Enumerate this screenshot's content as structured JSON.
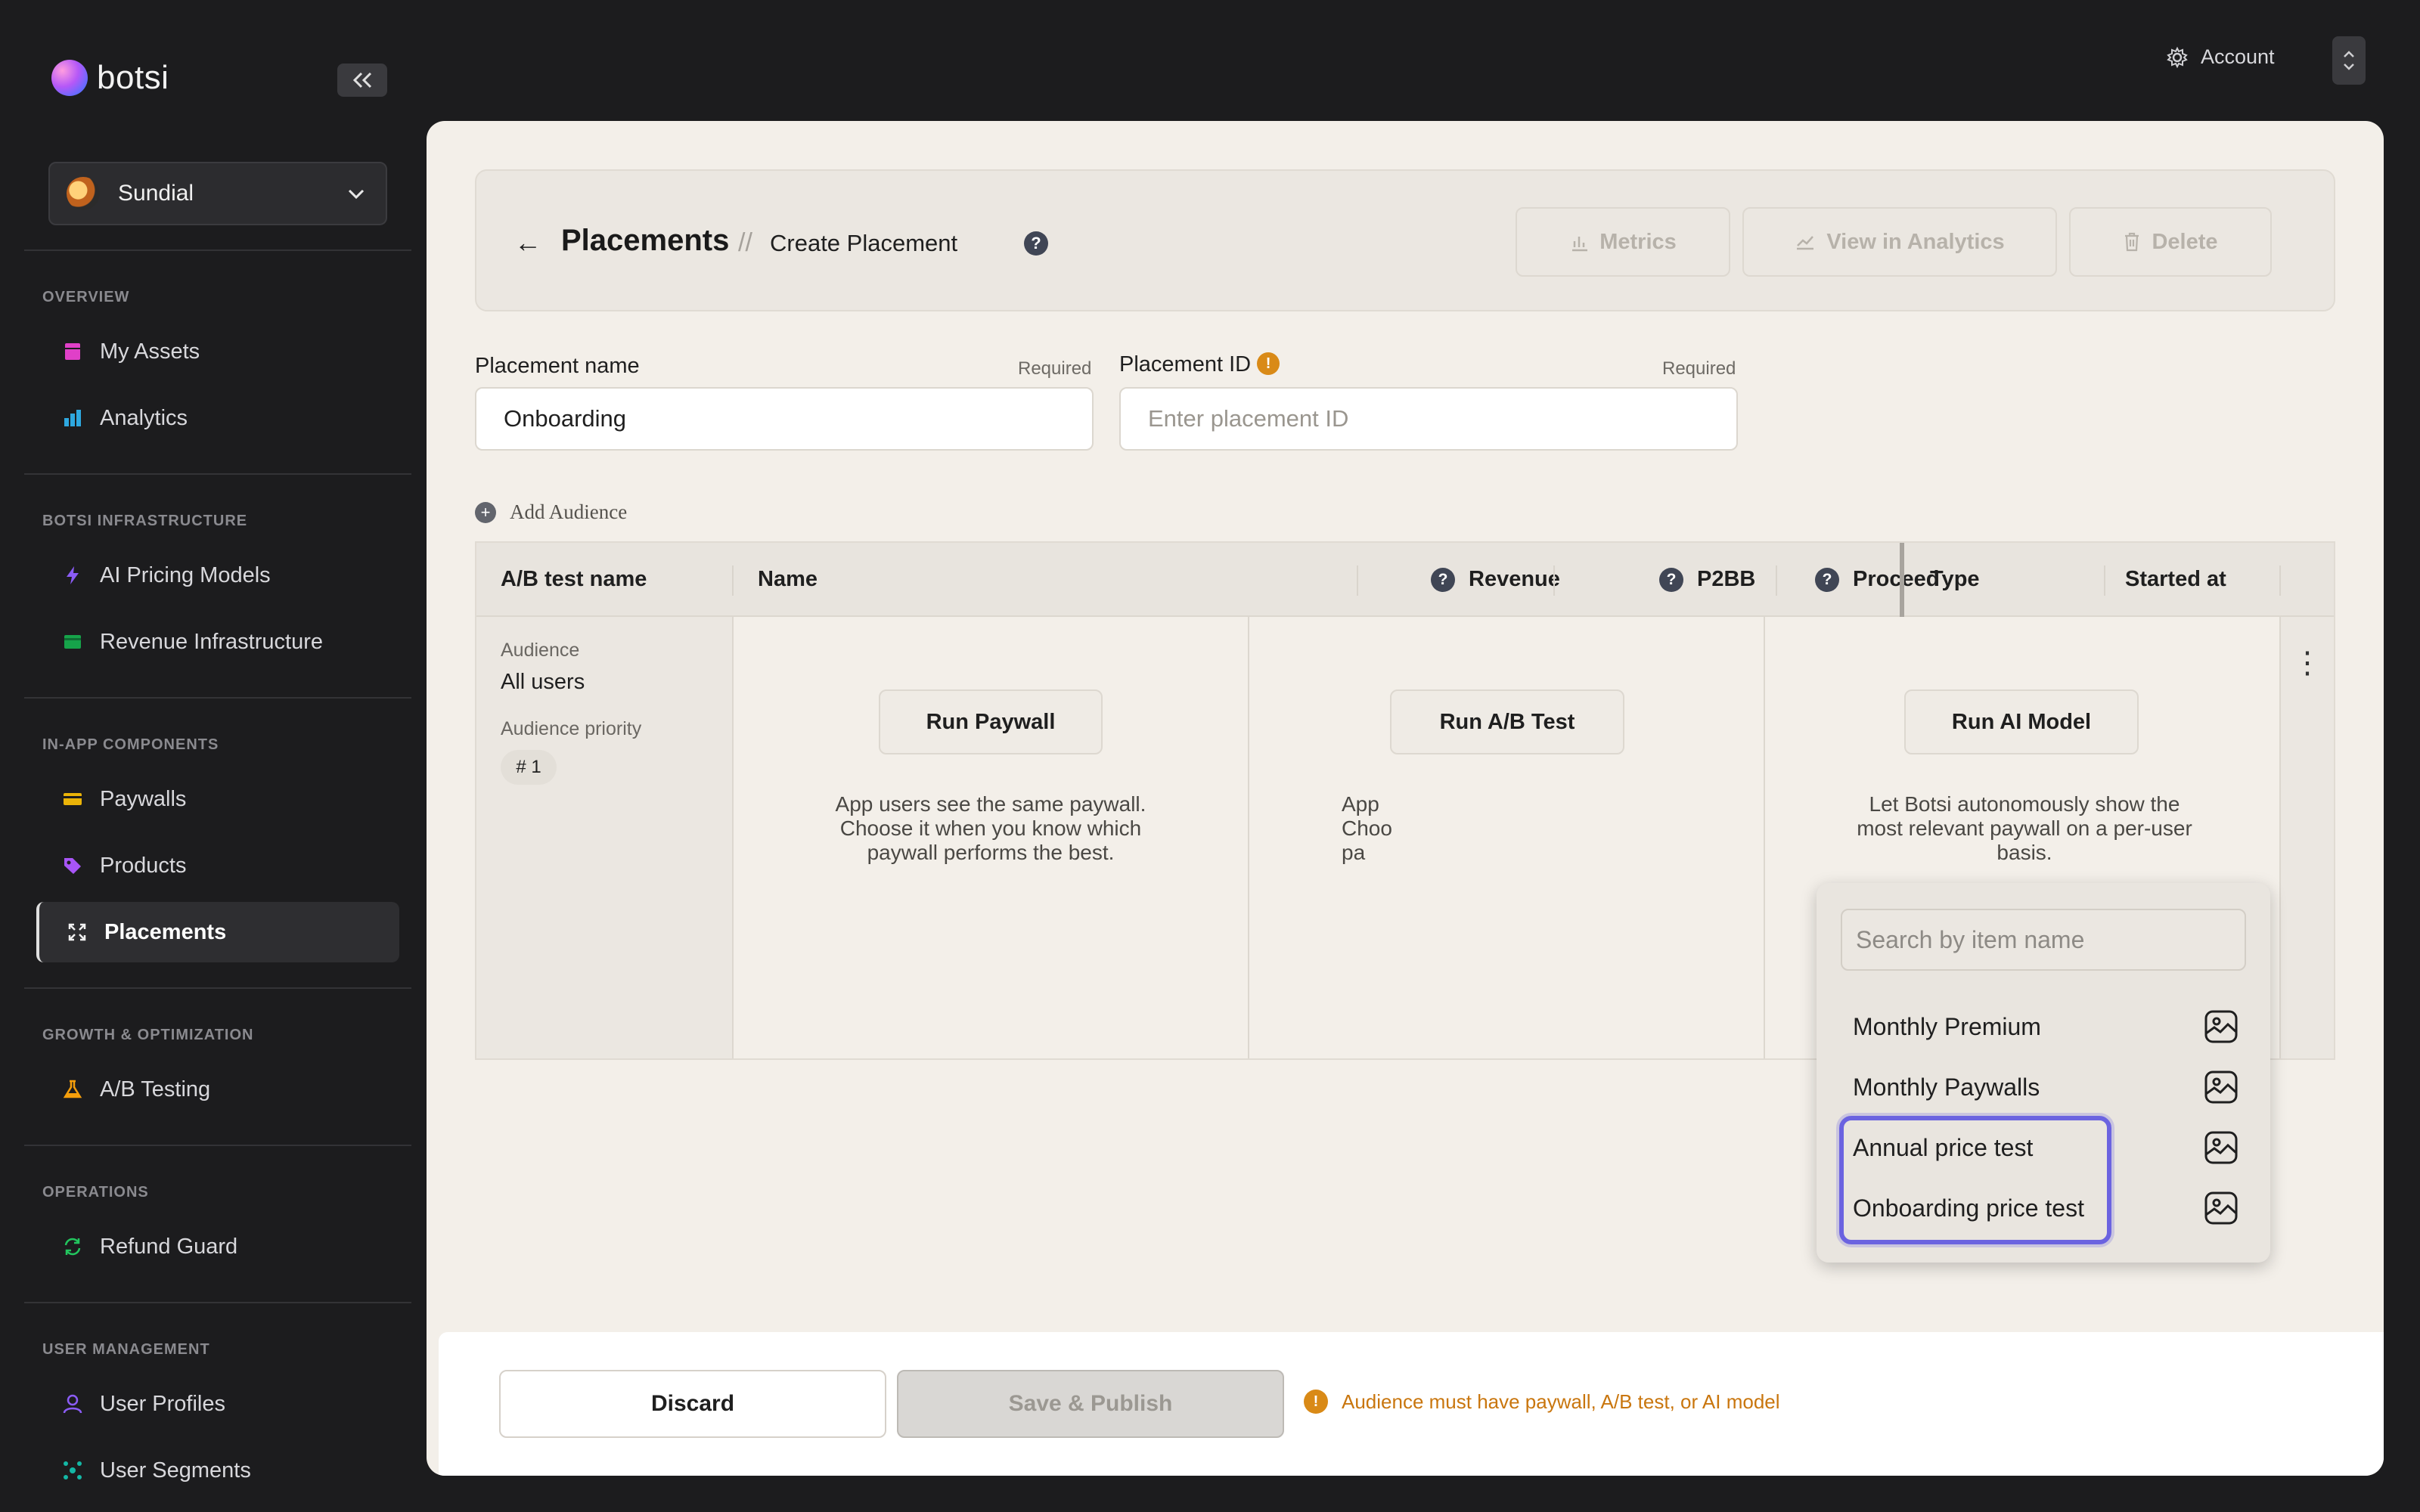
{
  "brand": {
    "name": "botsi"
  },
  "workspace": {
    "name": "Sundial"
  },
  "sidebar": {
    "sections": [
      {
        "label": "OVERVIEW",
        "items": [
          {
            "label": "My Assets",
            "icon": "assets-icon"
          },
          {
            "label": "Analytics",
            "icon": "bar-chart-icon"
          }
        ]
      },
      {
        "label": "BOTSI INFRASTRUCTURE",
        "items": [
          {
            "label": "AI Pricing Models",
            "icon": "lightning-icon"
          },
          {
            "label": "Revenue Infrastructure",
            "icon": "revenue-icon"
          }
        ]
      },
      {
        "label": "IN-APP COMPONENTS",
        "items": [
          {
            "label": "Paywalls",
            "icon": "card-icon"
          },
          {
            "label": "Products",
            "icon": "tag-icon"
          },
          {
            "label": "Placements",
            "icon": "expand-icon",
            "active": true
          }
        ]
      },
      {
        "label": "GROWTH & OPTIMIZATION",
        "items": [
          {
            "label": "A/B Testing",
            "icon": "flask-icon"
          }
        ]
      },
      {
        "label": "OPERATIONS",
        "items": [
          {
            "label": "Refund Guard",
            "icon": "refresh-icon"
          }
        ]
      },
      {
        "label": "USER MANAGEMENT",
        "items": [
          {
            "label": "User Profiles",
            "icon": "user-icon"
          },
          {
            "label": "User Segments",
            "icon": "segments-icon"
          }
        ]
      }
    ]
  },
  "topbar": {
    "account_label": "Account"
  },
  "header": {
    "title": "Placements",
    "separator": "//",
    "subtitle": "Create Placement",
    "buttons": {
      "metrics": "Metrics",
      "analytics": "View in Analytics",
      "delete": "Delete"
    }
  },
  "form": {
    "name_label": "Placement name",
    "name_required": "Required",
    "name_value": "Onboarding",
    "id_label": "Placement ID",
    "id_required": "Required",
    "id_placeholder": "Enter placement ID"
  },
  "add_audience_label": "Add Audience",
  "table": {
    "columns": {
      "ab_test_name": "A/B test name",
      "name": "Name",
      "revenue": "Revenue",
      "p2bb": "P2BB",
      "proceeds": "Proceed",
      "type": "Type",
      "started_at": "Started at"
    },
    "row": {
      "audience_label": "Audience",
      "audience_value": "All users",
      "priority_label": "Audience priority",
      "priority_value": "# 1"
    },
    "options": {
      "paywall": {
        "button": "Run Paywall",
        "desc": "App users see the same paywall. Choose it when you know which paywall performs the best."
      },
      "ab_test": {
        "button": "Run A/B Test",
        "desc_visible": "App\nChoo\npa"
      },
      "ai_model": {
        "button": "Run AI Model",
        "desc": "Let Botsi autonomously show the most relevant paywall on a per-user basis."
      }
    }
  },
  "dropdown": {
    "search_placeholder": "Search by item name",
    "items": [
      "Monthly Premium",
      "Monthly Paywalls",
      "Annual price test",
      "Onboarding price test"
    ]
  },
  "footer": {
    "discard": "Discard",
    "save": "Save & Publish",
    "warning": "Audience must have paywall, A/B test, or AI model"
  }
}
